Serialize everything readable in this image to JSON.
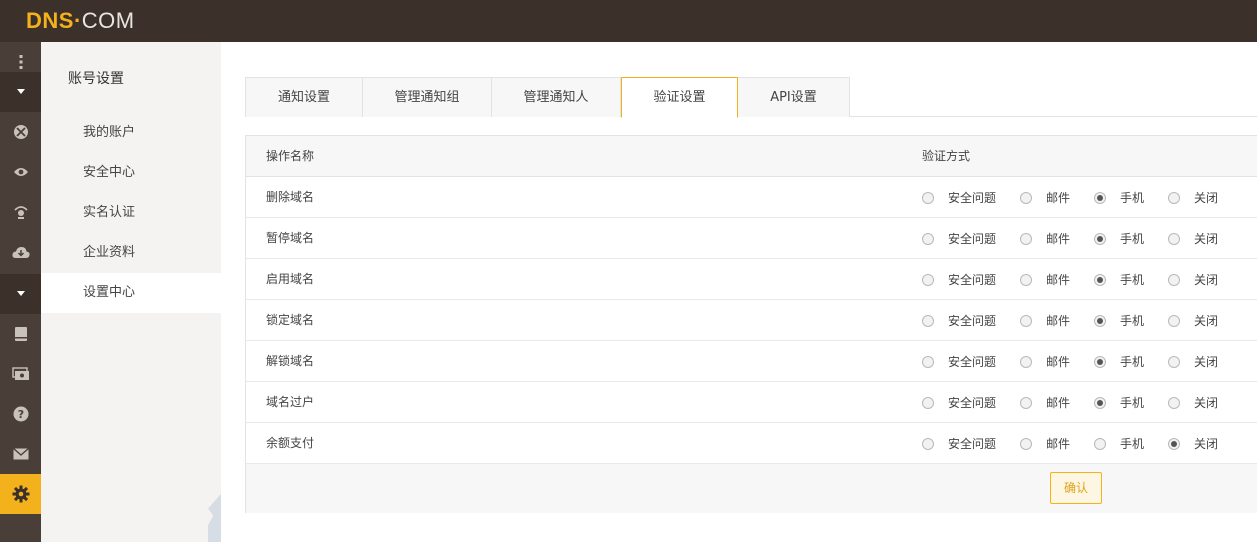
{
  "brand": {
    "logo_dns": "DNS",
    "logo_dot": "·",
    "logo_com": "COM"
  },
  "rail": {
    "items": [
      {
        "icon": "more-vertical-icon"
      },
      {
        "icon": "caret-down-icon"
      },
      {
        "icon": "globe-icon"
      },
      {
        "icon": "eye-icon"
      },
      {
        "icon": "monitor-signal-icon"
      },
      {
        "icon": "cloud-icon"
      },
      {
        "icon": "caret-down-icon"
      },
      {
        "icon": "book-icon"
      },
      {
        "icon": "money-icon"
      },
      {
        "icon": "help-icon"
      },
      {
        "icon": "mail-icon"
      },
      {
        "icon": "gear-icon"
      }
    ],
    "active_color": "#f3b21b"
  },
  "sidebar": {
    "title": "账号设置",
    "items": [
      {
        "label": "我的账户"
      },
      {
        "label": "安全中心"
      },
      {
        "label": "实名认证"
      },
      {
        "label": "企业资料"
      },
      {
        "label": "设置中心"
      }
    ]
  },
  "tabs": [
    {
      "label": "通知设置"
    },
    {
      "label": "管理通知组"
    },
    {
      "label": "管理通知人"
    },
    {
      "label": "验证设置"
    },
    {
      "label": "API设置"
    }
  ],
  "table": {
    "headers": {
      "name": "操作名称",
      "method": "验证方式"
    },
    "options": [
      "安全问题",
      "邮件",
      "手机",
      "关闭"
    ],
    "rows": [
      {
        "name": "删除域名",
        "selected": "手机"
      },
      {
        "name": "暂停域名",
        "selected": "手机"
      },
      {
        "name": "启用域名",
        "selected": "手机"
      },
      {
        "name": "锁定域名",
        "selected": "手机"
      },
      {
        "name": "解锁域名",
        "selected": "手机"
      },
      {
        "name": "域名过户",
        "selected": "手机"
      },
      {
        "name": "余额支付",
        "selected": "关闭"
      }
    ],
    "confirm_label": "确认"
  }
}
